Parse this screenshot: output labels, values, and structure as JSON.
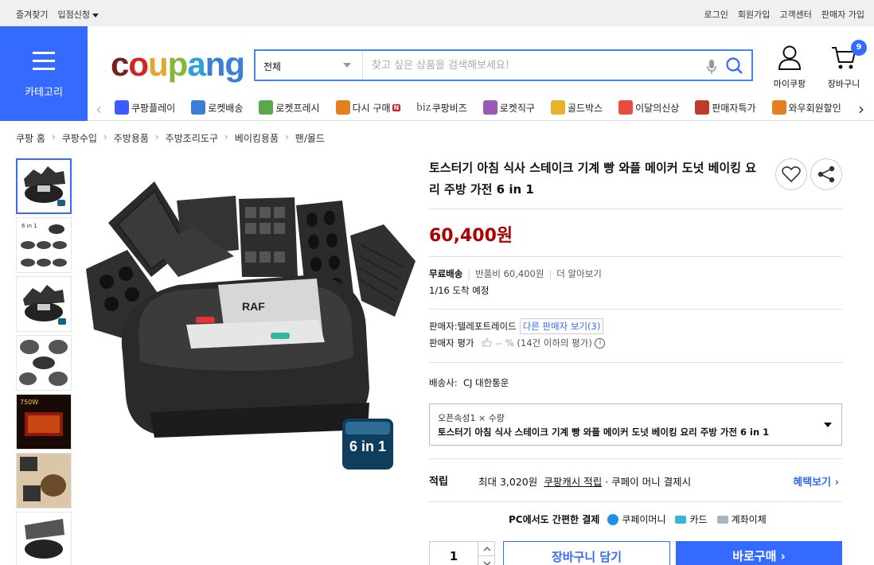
{
  "topbar": {
    "left": [
      "즐겨찾기",
      "입점신청"
    ],
    "right": [
      "로그인",
      "회원가입",
      "고객센터",
      "판매자 가입"
    ]
  },
  "header": {
    "category_label": "카테고리",
    "logo": {
      "c1": "c",
      "c2": "o",
      "c3": "u",
      "c4": "p",
      "c5": "a",
      "c6": "ng"
    },
    "search_scope": "전체",
    "search_placeholder": "찾고 싶은 상품을 검색해보세요!",
    "mycoupang_label": "마이쿠팡",
    "cart_label": "장바구니",
    "cart_count": "9"
  },
  "nav": {
    "items": [
      {
        "label": "쿠팡플레이",
        "color": "#3a5cff"
      },
      {
        "label": "로켓배송",
        "color": "#3a7fd5"
      },
      {
        "label": "로켓프레시",
        "color": "#5aa84a"
      },
      {
        "label": "다시 구매",
        "color": "#e67e22",
        "badge": "N"
      },
      {
        "label": "쿠팡비즈",
        "prefix": "biz",
        "color": "#333333"
      },
      {
        "label": "로켓직구",
        "color": "#9b59b6"
      },
      {
        "label": "골드박스",
        "color": "#e6b42b"
      },
      {
        "label": "이달의신상",
        "color": "#e74c3c"
      },
      {
        "label": "판매자특가",
        "color": "#c0392b"
      },
      {
        "label": "와우회원할인",
        "color": "#e67e22"
      }
    ]
  },
  "breadcrumb": [
    "쿠팡 홈",
    "쿠팡수입",
    "주방용품",
    "주방조리도구",
    "베이킹용품",
    "팬/몰드"
  ],
  "product": {
    "title": "토스터기 아침 식사 스테이크 기계 빵 와플 메이커 도넛 베이킹 요리 주방 가전 6 in 1",
    "price": "60,400원",
    "free_shipping": "무료배송",
    "return_fee": "반품비 60,400원",
    "learn_more": "더 알아보기",
    "arrival": "1/16 도착 예정",
    "seller_label": "판매자:",
    "seller_name": "텔레포트레이드",
    "other_sellers": "다른 판매자 보기(3)",
    "rating_label": "판매자 평가",
    "rating_value": "-- %",
    "rating_note": "(14건 이하의 평가)",
    "carrier_label": "배송사:",
    "carrier_name": "CJ 대한통운",
    "option_label": "오픈속성1 × 수량",
    "option_value": "토스터기 아침 식사 스테이크 기계 빵 와플 메이커 도넛 베이킹 요리 주방 가전 6 in 1",
    "brand_on_device": "RAF",
    "six_in_one": "6 in 1"
  },
  "reward": {
    "label": "적립",
    "text1": "최대 3,020원",
    "link": "쿠팡캐시 적립",
    "text2": "· 쿠페이 머니 결제시",
    "more": "혜택보기 ›"
  },
  "pay": {
    "title": "PC에서도 간편한 결제",
    "methods": [
      "쿠페이머니",
      "카드",
      "계좌이체"
    ]
  },
  "purchase": {
    "qty": "1",
    "cart_button": "장바구니 담기",
    "buy_button": "바로구매 ›"
  }
}
